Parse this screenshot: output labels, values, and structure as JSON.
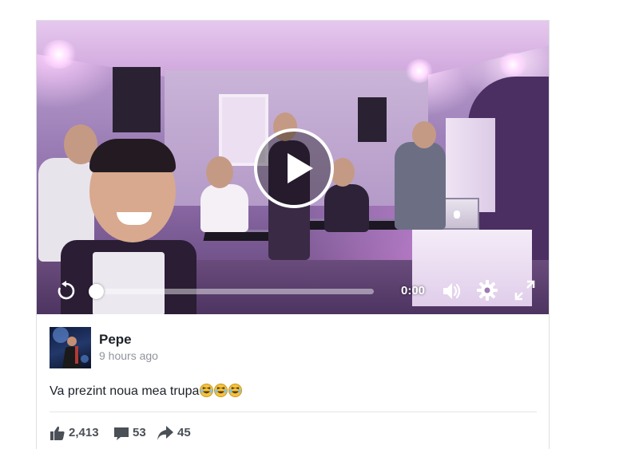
{
  "video": {
    "time": "0:00",
    "progress": 0,
    "icons": {
      "play": "play-icon",
      "replay": "replay-icon",
      "volume": "volume-icon",
      "settings": "gear-icon",
      "fullscreen": "fullscreen-icon"
    }
  },
  "post": {
    "author": "Pepe",
    "timestamp": "9 hours ago",
    "text": "Va prezint noua mea trupa",
    "emoji": [
      "laughing-face",
      "laughing-face",
      "laughing-face"
    ]
  },
  "stats": {
    "likes": "2,413",
    "comments": "53",
    "shares": "45"
  },
  "colors": {
    "text_primary": "#1d2129",
    "text_secondary": "#90949c",
    "stat_text": "#4b4f56",
    "border": "#dddfe2",
    "video_tint": "#a78bc0"
  }
}
